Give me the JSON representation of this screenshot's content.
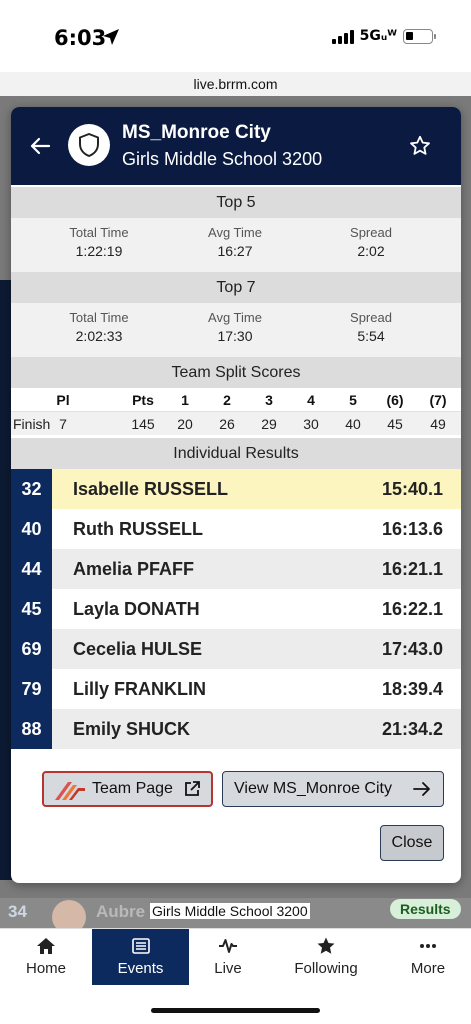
{
  "status_bar": {
    "time": "6:03",
    "network": "5Gᵤᵂ"
  },
  "browser": {
    "url": "live.brrm.com"
  },
  "background": {
    "rank": "34",
    "name": "Aubre",
    "school": "Girls Middle School 3200",
    "badge": "Results"
  },
  "modal": {
    "team_name": "MS_Monroe City",
    "subtitle": "Girls Middle School 3200",
    "top5": {
      "title": "Top 5",
      "stats": [
        {
          "label": "Total Time",
          "value": "1:22:19"
        },
        {
          "label": "Avg Time",
          "value": "16:27"
        },
        {
          "label": "Spread",
          "value": "2:02"
        }
      ]
    },
    "top7": {
      "title": "Top 7",
      "stats": [
        {
          "label": "Total Time",
          "value": "2:02:33"
        },
        {
          "label": "Avg Time",
          "value": "17:30"
        },
        {
          "label": "Spread",
          "value": "5:54"
        }
      ]
    },
    "split": {
      "title": "Team Split Scores",
      "headers": [
        "Pl",
        "Pts",
        "1",
        "2",
        "3",
        "4",
        "5",
        "(6)",
        "(7)"
      ],
      "row_label": "Finish",
      "values": [
        "7",
        "145",
        "20",
        "26",
        "29",
        "30",
        "40",
        "45",
        "49"
      ]
    },
    "individual": {
      "title": "Individual Results",
      "rows": [
        {
          "place": "32",
          "name": "Isabelle RUSSELL",
          "time": "15:40.1"
        },
        {
          "place": "40",
          "name": "Ruth RUSSELL",
          "time": "16:13.6"
        },
        {
          "place": "44",
          "name": "Amelia PFAFF",
          "time": "16:21.1"
        },
        {
          "place": "45",
          "name": "Layla DONATH",
          "time": "16:22.1"
        },
        {
          "place": "69",
          "name": "Cecelia HULSE",
          "time": "17:43.0"
        },
        {
          "place": "79",
          "name": "Lilly FRANKLIN",
          "time": "18:39.4"
        },
        {
          "place": "88",
          "name": "Emily SHUCK",
          "time": "21:34.2"
        }
      ]
    },
    "buttons": {
      "team_page": "Team Page",
      "view_team": "View MS_Monroe City",
      "close": "Close"
    }
  },
  "nav": {
    "items": [
      {
        "label": "Home",
        "icon": "home-icon"
      },
      {
        "label": "Events",
        "icon": "list-icon",
        "active": true
      },
      {
        "label": "Live",
        "icon": "pulse-icon"
      },
      {
        "label": "Following",
        "icon": "star-icon"
      },
      {
        "label": "More",
        "icon": "more-icon"
      }
    ]
  },
  "colors": {
    "navy": "#0b1a40",
    "rank_blue": "#0d2a5e",
    "highlight": "#fdf5c0",
    "team_button_border": "#b8342f"
  }
}
